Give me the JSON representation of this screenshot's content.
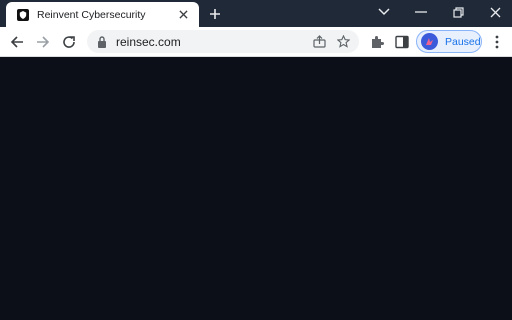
{
  "tab": {
    "title": "Reinvent Cybersecurity",
    "favicon": "shield-icon"
  },
  "window_controls": [
    "chevron-down-icon",
    "minimize-icon",
    "restore-icon",
    "close-icon"
  ],
  "omnibox": {
    "url": "reinsec.com"
  },
  "toolbar": {
    "profile_label": "Paused"
  },
  "page": {
    "background": "#0c0f18"
  },
  "colors": {
    "tabstrip": "#1f2937",
    "accent": "#1a73e8"
  }
}
